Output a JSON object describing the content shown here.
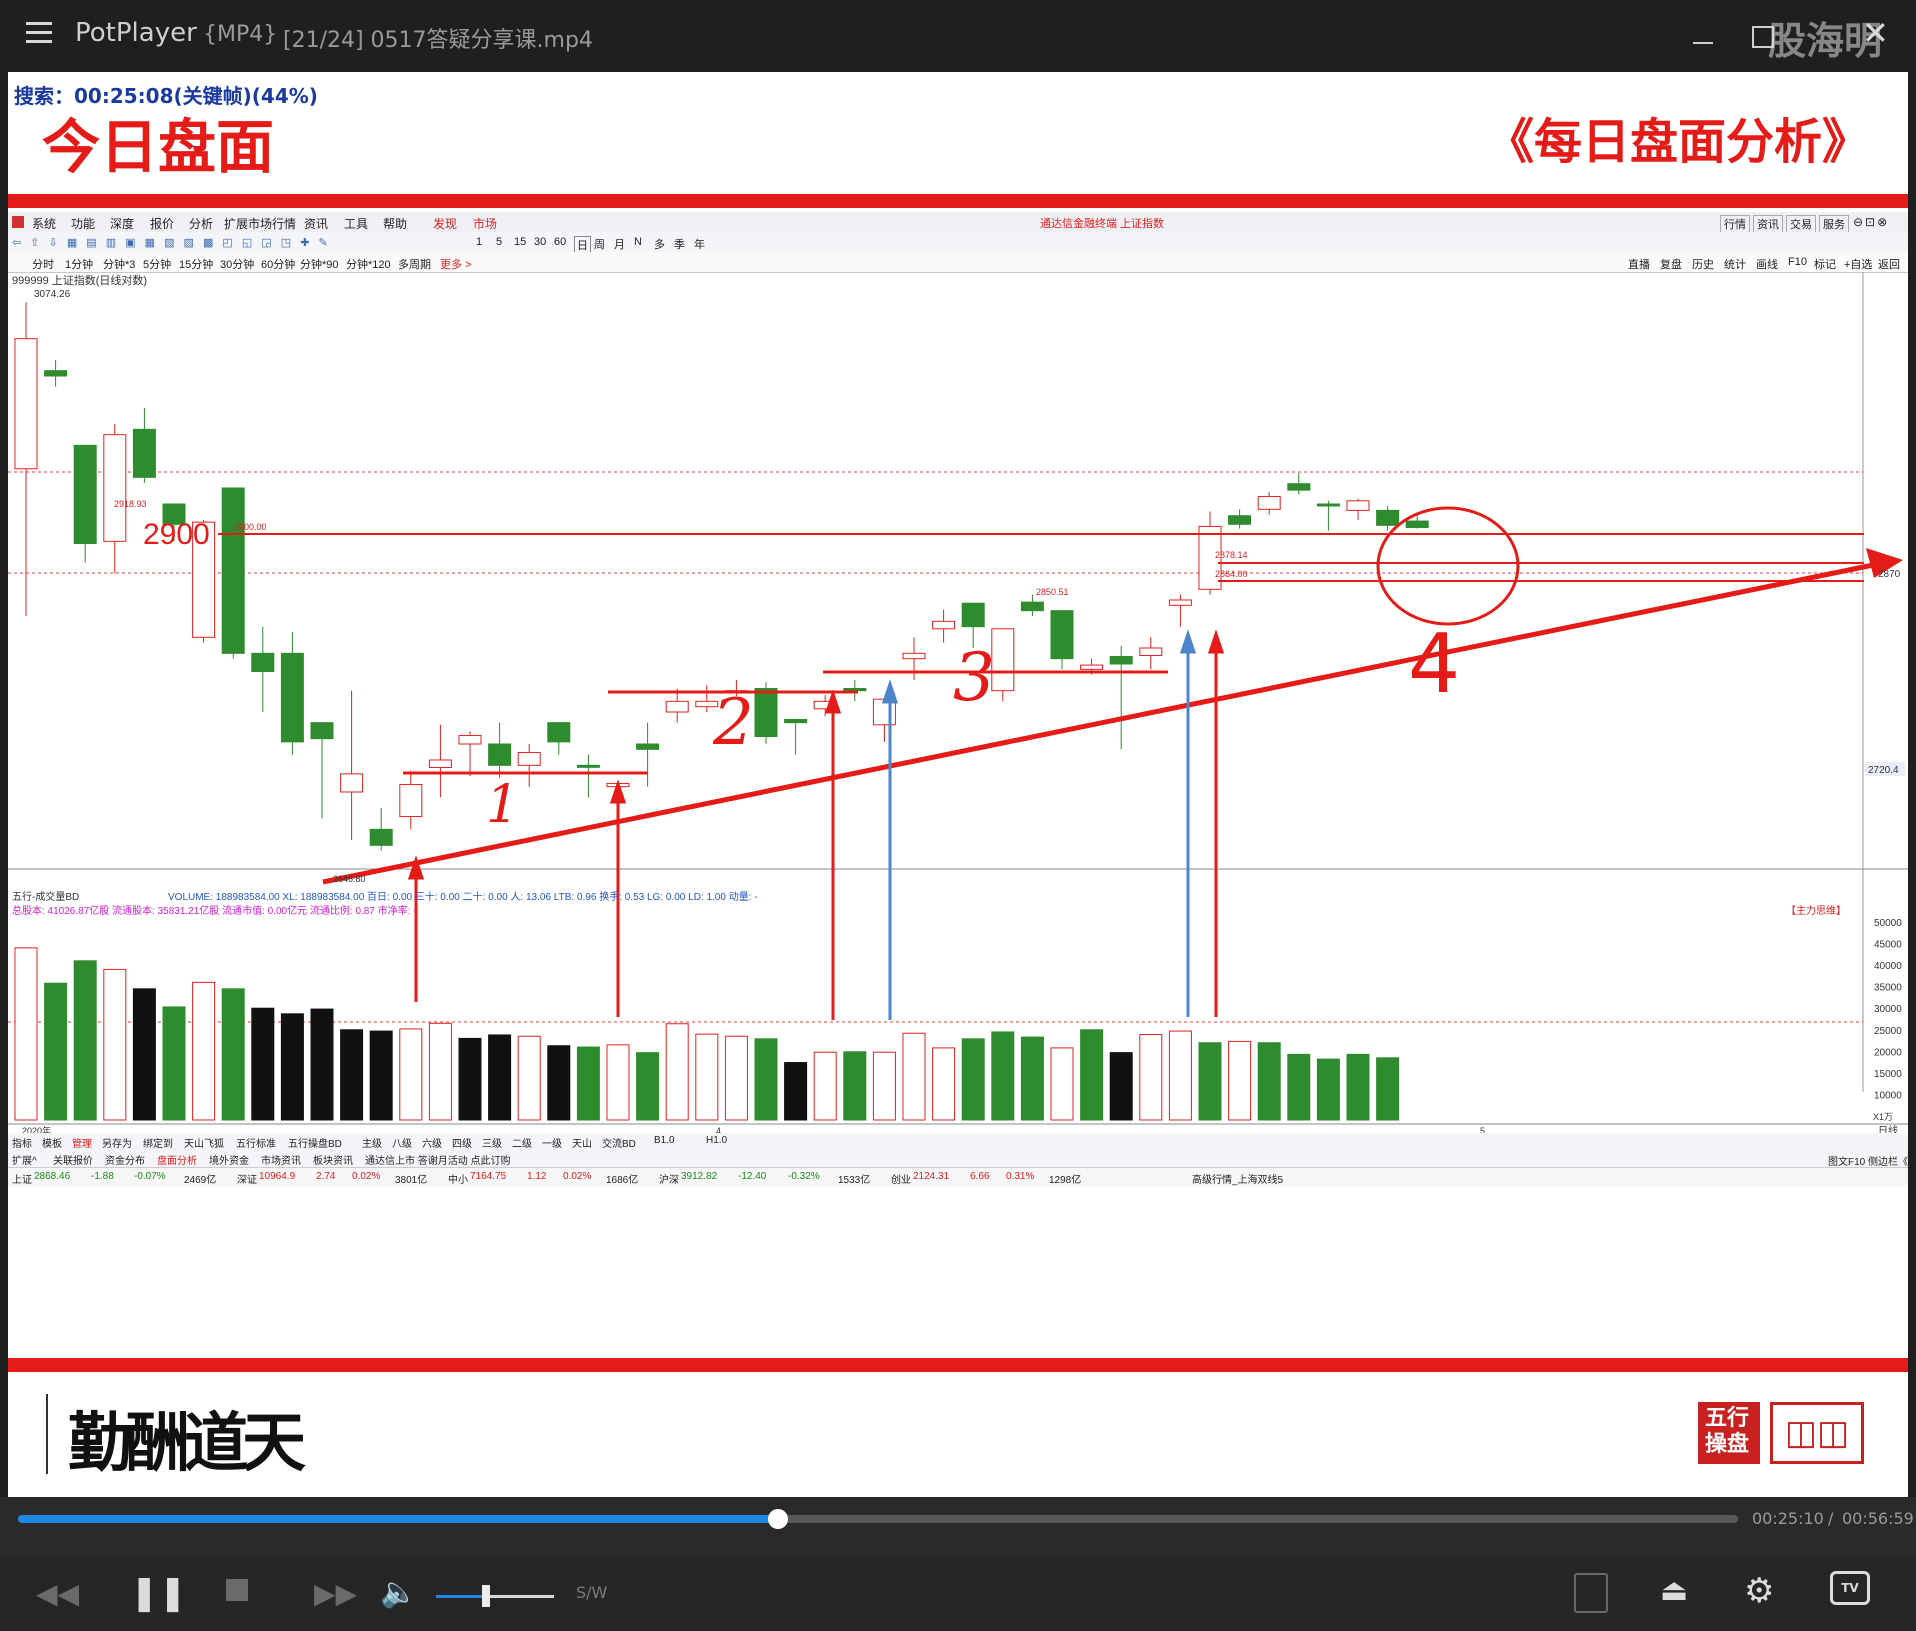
{
  "window": {
    "app_name": "PotPlayer",
    "format_tag": "{MP4}",
    "file_title": "[21/24] 0517答疑分享课.mp4",
    "watermark": "股海明灯"
  },
  "video": {
    "search_status": "搜索：00:25:08(关键帧)(44%)",
    "heading_left": "今日盘面",
    "heading_right": "《每日盘面分析》",
    "calligraphy": "天道酬勤",
    "seal_text": "五行操盘"
  },
  "software": {
    "menu": [
      "系统",
      "功能",
      "深度",
      "报价",
      "分析",
      "扩展市场行情",
      "资讯",
      "工具",
      "帮助"
    ],
    "menu_red": [
      "发现",
      "市场"
    ],
    "window_title": "通达信金融终端 上证指数",
    "right_menu": [
      "行情",
      "资讯",
      "交易",
      "服务"
    ],
    "period_row": [
      "1",
      "5",
      "15",
      "30",
      "60",
      "日",
      "周",
      "月",
      "N",
      "多",
      "季",
      "年"
    ],
    "tabs": [
      "分时",
      "1分钟",
      "分钟*3",
      "5分钟",
      "15分钟",
      "30分钟",
      "60分钟",
      "分钟*90",
      "分钟*120",
      "多周期",
      "更多 >"
    ],
    "right_tabs": [
      "直播",
      "复盘",
      "历史",
      "统计",
      "画线",
      "F10",
      "标记",
      "+自选",
      "返回"
    ],
    "index_label": "999999 上证指数(日线对数)",
    "price_top": "3074.26",
    "price_2918": "2918.93",
    "price_2900": "2900.00",
    "price_2878": "2878.14",
    "price_2864": "2864.00",
    "price_2850": "2850.51",
    "price_2646": "2646.80",
    "axis_2870": "2870",
    "axis_2720": "2720.4",
    "annot_2900": "2900",
    "annot_1": "1",
    "annot_2": "2",
    "annot_3": "3",
    "annot_4": "4",
    "vol_header": "五行-成交量BD",
    "vol_stats": "VOLUME: 188983584.00  XL: 188983584.00  百日: 0.00  三十: 0.00  二十: 0.00  人: 13.06  LTB: 0.96  换手: 0.53  LG: 0.00  LD: 1.00  动量: -",
    "vol_stats2": "总股本:     41026.87亿股     流通股本:     35831.21亿股     流通市值:      0.00亿元     流通比例:       0.87     市净率:        -",
    "vol_tag": "【主力思维】",
    "vol_axis": [
      "50000",
      "45000",
      "40000",
      "35000",
      "30000",
      "25000",
      "20000",
      "15000",
      "10000"
    ],
    "vol_unit": "X1万",
    "year_label": "2020年",
    "month4": "4",
    "month5": "5",
    "daily": "日线",
    "bottom_tabs": [
      "指标",
      "模板",
      "管理",
      "另存为",
      "绑定到",
      "天山飞狐",
      "五行标准",
      "五行操盘BD",
      "主级",
      "八级",
      "六级",
      "四级",
      "三级",
      "二级",
      "一级",
      "天山",
      "交流BD",
      "B1.0",
      "H1.0"
    ],
    "bottom_tabs2": [
      "扩展^",
      "关联报价",
      "资金分布",
      "盘面分析",
      "境外资金",
      "市场资讯",
      "板块资讯",
      "通达信上市 答谢月活动 点此订购"
    ],
    "f10": "图文F10 侧边栏《",
    "status_bar": [
      {
        "name": "上证",
        "val": "2868.46",
        "chg": "-1.88",
        "pct": "-0.07%",
        "amt": "2469亿"
      },
      {
        "name": "深证",
        "val": "10964.9",
        "chg": "2.74",
        "pct": "0.02%",
        "amt": "3801亿"
      },
      {
        "name": "中小",
        "val": "7164.75",
        "chg": "1.12",
        "pct": "0.02%",
        "amt": "1686亿"
      },
      {
        "name": "沪深",
        "val": "3912.82",
        "chg": "-12.40",
        "pct": "-0.32%",
        "amt": "1533亿"
      },
      {
        "name": "创业",
        "val": "2124.31",
        "chg": "6.66",
        "pct": "0.31%",
        "amt": "1298亿"
      }
    ],
    "status_right": "高级行情_上海双线5"
  },
  "player": {
    "time_current": "00:25:10",
    "time_total": "00:56:59",
    "progress_fraction": 0.442,
    "volume_fraction": 0.42,
    "sw_label": "S/W"
  },
  "chart_data": {
    "type": "candlestick",
    "series": [
      {
        "o": 2918,
        "h": 3074,
        "l": 2780,
        "c": 3040,
        "up": true
      },
      {
        "o": 3010,
        "h": 3020,
        "l": 2995,
        "c": 3005,
        "up": false
      },
      {
        "o": 2940,
        "h": 2940,
        "l": 2830,
        "c": 2848,
        "up": false
      },
      {
        "o": 2850,
        "h": 2960,
        "l": 2820,
        "c": 2950,
        "up": true
      },
      {
        "o": 2955,
        "h": 2975,
        "l": 2905,
        "c": 2910,
        "up": false
      },
      {
        "o": 2885,
        "h": 2880,
        "l": 2850,
        "c": 2866,
        "up": false
      },
      {
        "o": 2760,
        "h": 2870,
        "l": 2755,
        "c": 2868,
        "up": true
      },
      {
        "o": 2900,
        "h": 2900,
        "l": 2740,
        "c": 2745,
        "up": false
      },
      {
        "o": 2745,
        "h": 2770,
        "l": 2690,
        "c": 2728,
        "up": false
      },
      {
        "o": 2745,
        "h": 2765,
        "l": 2650,
        "c": 2662,
        "up": false
      },
      {
        "o": 2680,
        "h": 2650,
        "l": 2590,
        "c": 2665,
        "up": false
      },
      {
        "o": 2615,
        "h": 2710,
        "l": 2570,
        "c": 2632,
        "up": true
      },
      {
        "o": 2580,
        "h": 2600,
        "l": 2560,
        "c": 2565,
        "up": false
      },
      {
        "o": 2592,
        "h": 2635,
        "l": 2580,
        "c": 2622,
        "up": true
      },
      {
        "o": 2638,
        "h": 2678,
        "l": 2610,
        "c": 2645,
        "up": true
      },
      {
        "o": 2660,
        "h": 2672,
        "l": 2630,
        "c": 2668,
        "up": true
      },
      {
        "o": 2660,
        "h": 2680,
        "l": 2628,
        "c": 2640,
        "up": false
      },
      {
        "o": 2640,
        "h": 2660,
        "l": 2620,
        "c": 2652,
        "up": true
      },
      {
        "o": 2680,
        "h": 2660,
        "l": 2650,
        "c": 2662,
        "up": false
      },
      {
        "o": 2640,
        "h": 2650,
        "l": 2610,
        "c": 2640,
        "up": false
      },
      {
        "o": 2623,
        "h": 2625,
        "l": 2618,
        "c": 2620,
        "up": true
      },
      {
        "o": 2660,
        "h": 2680,
        "l": 2620,
        "c": 2655,
        "up": false
      },
      {
        "o": 2690,
        "h": 2712,
        "l": 2680,
        "c": 2700,
        "up": true
      },
      {
        "o": 2700,
        "h": 2715,
        "l": 2690,
        "c": 2695,
        "up": true
      },
      {
        "o": 2708,
        "h": 2720,
        "l": 2705,
        "c": 2710,
        "up": true
      },
      {
        "o": 2712,
        "h": 2718,
        "l": 2660,
        "c": 2667,
        "up": false
      },
      {
        "o": 2683,
        "h": 2670,
        "l": 2650,
        "c": 2680,
        "up": false
      },
      {
        "o": 2693,
        "h": 2706,
        "l": 2686,
        "c": 2700,
        "up": true
      },
      {
        "o": 2710,
        "h": 2720,
        "l": 2700,
        "c": 2712,
        "up": false
      },
      {
        "o": 2678,
        "h": 2675,
        "l": 2662,
        "c": 2702,
        "up": true
      },
      {
        "o": 2740,
        "h": 2760,
        "l": 2720,
        "c": 2745,
        "up": true
      },
      {
        "o": 2768,
        "h": 2786,
        "l": 2755,
        "c": 2775,
        "up": true
      },
      {
        "o": 2792,
        "h": 2780,
        "l": 2750,
        "c": 2770,
        "up": false
      },
      {
        "o": 2710,
        "h": 2765,
        "l": 2700,
        "c": 2768,
        "up": true
      },
      {
        "o": 2793,
        "h": 2800,
        "l": 2780,
        "c": 2785,
        "up": false
      },
      {
        "o": 2785,
        "h": 2780,
        "l": 2730,
        "c": 2740,
        "up": false
      },
      {
        "o": 2734,
        "h": 2740,
        "l": 2725,
        "c": 2730,
        "up": true
      },
      {
        "o": 2742,
        "h": 2752,
        "l": 2655,
        "c": 2735,
        "up": false
      },
      {
        "o": 2743,
        "h": 2760,
        "l": 2730,
        "c": 2750,
        "up": true
      },
      {
        "o": 2790,
        "h": 2800,
        "l": 2770,
        "c": 2795,
        "up": true
      },
      {
        "o": 2805,
        "h": 2878,
        "l": 2800,
        "c": 2864,
        "up": true
      },
      {
        "o": 2874,
        "h": 2880,
        "l": 2862,
        "c": 2866,
        "up": false
      },
      {
        "o": 2880,
        "h": 2896,
        "l": 2875,
        "c": 2892,
        "up": true
      },
      {
        "o": 2904,
        "h": 2914,
        "l": 2894,
        "c": 2898,
        "up": false
      },
      {
        "o": 2885,
        "h": 2888,
        "l": 2860,
        "c": 2884,
        "up": false
      },
      {
        "o": 2879,
        "h": 2890,
        "l": 2870,
        "c": 2888,
        "up": true
      },
      {
        "o": 2879,
        "h": 2883,
        "l": 2860,
        "c": 2865,
        "up": false
      },
      {
        "o": 2869,
        "h": 2874,
        "l": 2862,
        "c": 2863,
        "up": false
      }
    ],
    "volumes": [
      {
        "v": 44000,
        "up": true
      },
      {
        "v": 35800,
        "up": false
      },
      {
        "v": 41000,
        "up": false
      },
      {
        "v": 39000,
        "up": true
      },
      {
        "v": 34500,
        "up": false
      },
      {
        "v": 30300,
        "up": false
      },
      {
        "v": 36000,
        "up": true
      },
      {
        "v": 34500,
        "up": false
      },
      {
        "v": 30000,
        "up": false
      },
      {
        "v": 28700,
        "up": false
      },
      {
        "v": 29800,
        "up": false
      },
      {
        "v": 25000,
        "up": false
      },
      {
        "v": 24700,
        "up": false
      },
      {
        "v": 25200,
        "up": true
      },
      {
        "v": 26500,
        "up": true
      },
      {
        "v": 23000,
        "up": false
      },
      {
        "v": 23800,
        "up": false
      },
      {
        "v": 23500,
        "up": true
      },
      {
        "v": 21300,
        "up": false
      },
      {
        "v": 21000,
        "up": false
      },
      {
        "v": 21500,
        "up": true
      },
      {
        "v": 19700,
        "up": false
      },
      {
        "v": 26400,
        "up": true
      },
      {
        "v": 24000,
        "up": true
      },
      {
        "v": 23500,
        "up": true
      },
      {
        "v": 22900,
        "up": false
      },
      {
        "v": 17400,
        "up": false
      },
      {
        "v": 19800,
        "up": true
      },
      {
        "v": 19900,
        "up": false
      },
      {
        "v": 19800,
        "up": true
      },
      {
        "v": 24200,
        "up": true
      },
      {
        "v": 20800,
        "up": true
      },
      {
        "v": 22900,
        "up": false
      },
      {
        "v": 24500,
        "up": false
      },
      {
        "v": 23300,
        "up": false
      },
      {
        "v": 20800,
        "up": true
      },
      {
        "v": 25000,
        "up": false
      },
      {
        "v": 19700,
        "up": false
      },
      {
        "v": 23900,
        "up": true
      },
      {
        "v": 24700,
        "up": true
      },
      {
        "v": 22000,
        "up": false
      },
      {
        "v": 22300,
        "up": true
      },
      {
        "v": 22000,
        "up": false
      },
      {
        "v": 19300,
        "up": false
      },
      {
        "v": 18200,
        "up": false
      },
      {
        "v": 19300,
        "up": false
      },
      {
        "v": 18500,
        "up": false
      }
    ]
  },
  "colors": {
    "up": "#e02020",
    "down": "#2e8b2e",
    "annotation": "#e41b17",
    "blue_arrow": "#4a86c8",
    "progress": "#1e88e5"
  }
}
